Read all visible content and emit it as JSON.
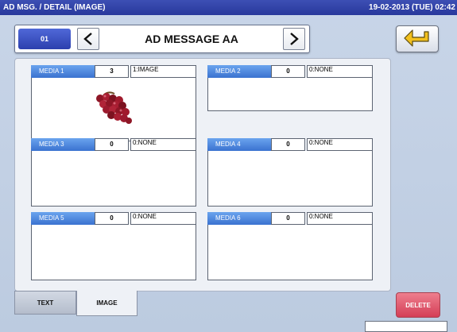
{
  "header": {
    "title": "AD MSG. / DETAIL (IMAGE)",
    "datetime": "19-02-2013 (TUE) 02:42"
  },
  "nav": {
    "number": "01",
    "message_name": "AD MESSAGE AA",
    "prev_icon": "chevron-left-icon",
    "next_icon": "chevron-right-icon",
    "back_icon": "return-arrow-icon"
  },
  "media": [
    {
      "label": "MEDIA 1",
      "count": "3",
      "type": "1:IMAGE",
      "has_image": true,
      "image_icon": "grapes-image"
    },
    {
      "label": "MEDIA 2",
      "count": "0",
      "type": "0:NONE",
      "has_image": false
    },
    {
      "label": "MEDIA 3",
      "count": "0",
      "type": "0:NONE",
      "has_image": false
    },
    {
      "label": "MEDIA 4",
      "count": "0",
      "type": "0:NONE",
      "has_image": false
    },
    {
      "label": "MEDIA 5",
      "count": "0",
      "type": "0:NONE",
      "has_image": false
    },
    {
      "label": "MEDIA 6",
      "count": "0",
      "type": "0:NONE",
      "has_image": false
    }
  ],
  "tabs": [
    {
      "label": "TEXT",
      "active": false
    },
    {
      "label": "IMAGE",
      "active": true
    }
  ],
  "actions": {
    "delete_label": "DELETE"
  },
  "colors": {
    "title_bar": "#28389c",
    "media_label": "#3a72d0",
    "delete": "#d43e56",
    "back_arrow": "#f2c01e"
  }
}
